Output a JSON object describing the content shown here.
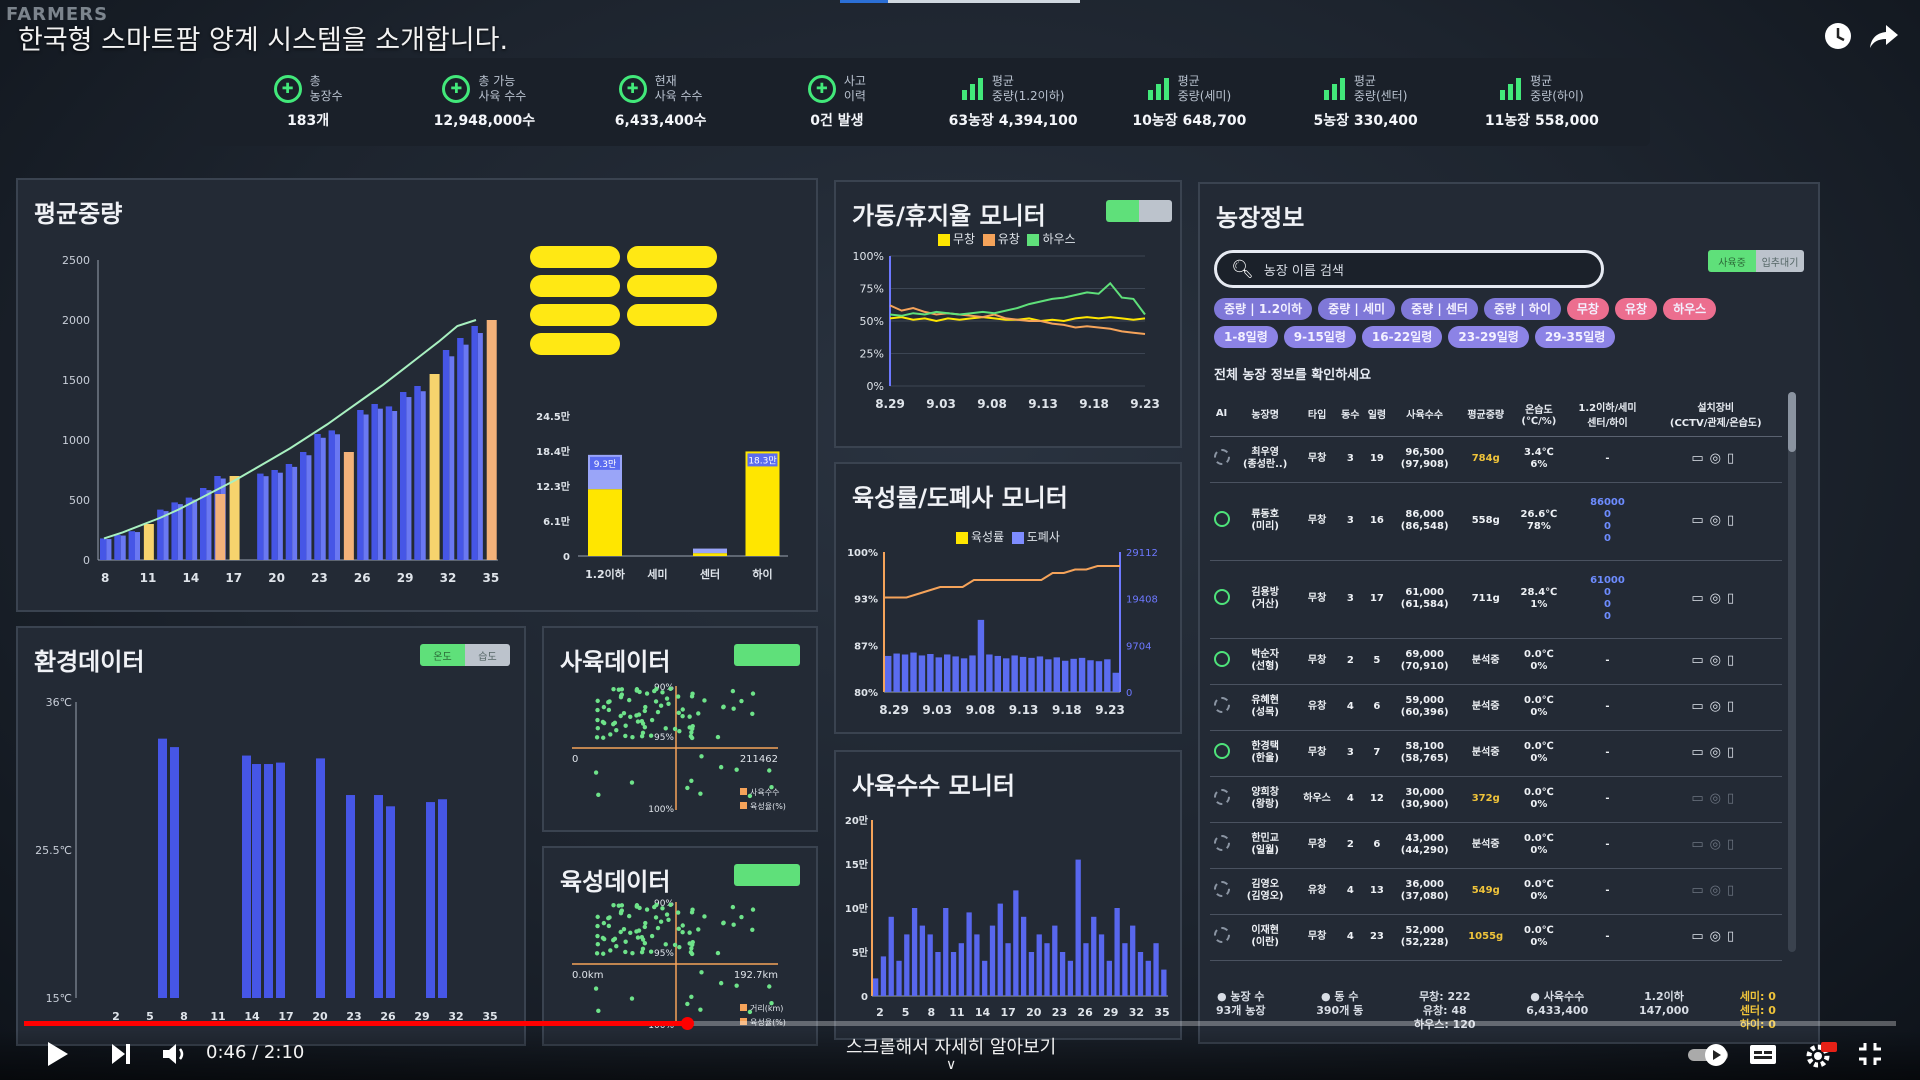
{
  "video": {
    "brand": "FARMERS",
    "title": "한국형 스마트팜 양계 시스템을 소개합니다.",
    "time": "0:46 / 2:10",
    "progress": 0.354,
    "scroll_hint": "스크롤해서 자세히 알아보기",
    "icons": [
      "clock-icon",
      "share-icon",
      "play-icon",
      "next-icon",
      "volume-icon",
      "autoplay-toggle",
      "captions-icon",
      "settings-icon",
      "fullscreen-exit-icon"
    ]
  },
  "stats": [
    {
      "label1": "총",
      "label2": "농장수",
      "value": "183개",
      "icon": "farm-icon"
    },
    {
      "label1": "총 가능",
      "label2": "사육 수수",
      "value": "12,948,000수",
      "icon": "capacity-icon"
    },
    {
      "label1": "현재",
      "label2": "사육 수수",
      "value": "6,433,400수",
      "icon": "current-icon"
    },
    {
      "label1": "사고",
      "label2": "이력",
      "value": "0건 발생",
      "icon": "accident-icon"
    },
    {
      "label1": "평균",
      "label2": "중량(1.2이하)",
      "value": "63농장 4,394,100",
      "icon": "bar-chart-icon"
    },
    {
      "label1": "평균",
      "label2": "중량(세미)",
      "value": "10농장 648,700",
      "icon": "bar-chart-icon"
    },
    {
      "label1": "평균",
      "label2": "중량(센터)",
      "value": "5농장 330,400",
      "icon": "bar-chart-icon"
    },
    {
      "label1": "평균",
      "label2": "중량(하이)",
      "value": "11농장 558,000",
      "icon": "bar-chart-icon"
    }
  ],
  "panels": {
    "avg_weight": {
      "title": "평균중량"
    },
    "operation": {
      "title": "가동/휴지율 모니터",
      "legend": [
        "무창",
        "유창",
        "하우스"
      ],
      "toggle": [
        "",
        ""
      ]
    },
    "growth": {
      "title": "육성률/도폐사 모니터",
      "legend": [
        "육성률",
        "도폐사"
      ]
    },
    "count": {
      "title": "사육수수 모니터"
    },
    "env": {
      "title": "환경데이터",
      "toggle": [
        "온도",
        "습도"
      ]
    },
    "breeding": {
      "title": "사육데이터",
      "legend": [
        "사육수수",
        "육성율(%)"
      ]
    },
    "raising": {
      "title": "육성데이터",
      "legend": [
        "거리(km)",
        "육성율(%)"
      ]
    },
    "farm": {
      "title": "농장정보",
      "search_placeholder": "농장 이름 검색",
      "toggle": [
        "사육중",
        "입추대기"
      ],
      "chips_row1": [
        "중량 | 1.2이하",
        "중량 | 세미",
        "중량 | 센터",
        "중량 | 하이",
        "무창",
        "유창",
        "하우스"
      ],
      "chips_row2": [
        "1-8일령",
        "9-15일령",
        "16-22일령",
        "23-29일령",
        "29-35일령"
      ],
      "subtitle": "전체 농장 정보를 확인하세요",
      "columns": [
        "AI",
        "농장명",
        "타입",
        "동수",
        "일령",
        "사육수수",
        "평균중량",
        "온습도 (℃/%)",
        "1.2이하/세미 센터/하이",
        "설치장비 (CCTV/관제/온습도)"
      ],
      "rows": [
        {
          "ai": false,
          "name": "최우영\n(종성란..)",
          "type": "무창",
          "dong": "3",
          "age": "19",
          "count": "96,500\n(97,908)",
          "weight": "784g",
          "weight_gold": true,
          "th": "3.4℃\n6%",
          "grade": "-"
        },
        {
          "ai": true,
          "name": "류동호\n(미리)",
          "type": "무창",
          "dong": "3",
          "age": "16",
          "count": "86,000\n(86,548)",
          "weight": "558g",
          "weight_gold": false,
          "th": "26.6℃\n78%",
          "grade": "86000\n0\n0\n0"
        },
        {
          "ai": true,
          "name": "김용방\n(거산)",
          "type": "무창",
          "dong": "3",
          "age": "17",
          "count": "61,000\n(61,584)",
          "weight": "711g",
          "weight_gold": false,
          "th": "28.4℃\n1%",
          "grade": "61000\n0\n0\n0"
        },
        {
          "ai": true,
          "name": "박순자\n(선형)",
          "type": "무창",
          "dong": "2",
          "age": "5",
          "count": "69,000\n(70,910)",
          "weight": "분석중",
          "weight_gold": false,
          "th": "0.0℃\n0%",
          "grade": "-"
        },
        {
          "ai": false,
          "name": "유혜현\n(성목)",
          "type": "유창",
          "dong": "4",
          "age": "6",
          "count": "59,000\n(60,396)",
          "weight": "분석중",
          "weight_gold": false,
          "th": "0.0℃\n0%",
          "grade": "-"
        },
        {
          "ai": true,
          "name": "한경택\n(한울)",
          "type": "무창",
          "dong": "3",
          "age": "7",
          "count": "58,100\n(58,765)",
          "weight": "분석중",
          "weight_gold": false,
          "th": "0.0℃\n0%",
          "grade": "-"
        },
        {
          "ai": false,
          "name": "양희창\n(왕랑)",
          "type": "하우스",
          "dong": "4",
          "age": "12",
          "count": "30,000\n(30,900)",
          "weight": "372g",
          "weight_gold": true,
          "th": "0.0℃\n0%",
          "grade": "-"
        },
        {
          "ai": false,
          "name": "한민교\n(일월)",
          "type": "무창",
          "dong": "2",
          "age": "6",
          "count": "43,000\n(44,290)",
          "weight": "분석중",
          "weight_gold": false,
          "th": "0.0℃\n0%",
          "grade": "-"
        },
        {
          "ai": false,
          "name": "김영오\n(김영오)",
          "type": "유창",
          "dong": "4",
          "age": "13",
          "count": "36,000\n(37,080)",
          "weight": "549g",
          "weight_gold": true,
          "th": "0.0℃\n0%",
          "grade": "-"
        },
        {
          "ai": false,
          "name": "이재현\n(이란)",
          "type": "무창",
          "dong": "4",
          "age": "23",
          "count": "52,000\n(52,228)",
          "weight": "1055g",
          "weight_gold": true,
          "th": "0.0℃\n0%",
          "grade": "-"
        }
      ],
      "footer": [
        {
          "label": "농장 수",
          "value": "93개 농장"
        },
        {
          "label": "동 수",
          "value": "390개 동"
        },
        {
          "label": "무창: 222",
          "value": "유창: 48\n하우스: 120"
        },
        {
          "label": "사육수수",
          "value": "6,433,400"
        },
        {
          "label": "1.2이하",
          "value": "147,000"
        },
        {
          "label": "세미: 0",
          "value": "센터: 0\n하이: 0"
        }
      ]
    }
  },
  "chart_data": [
    {
      "type": "bar",
      "title": "평균중량",
      "categories": [
        8,
        9,
        10,
        11,
        12,
        13,
        14,
        15,
        16,
        17,
        18,
        19,
        20,
        21,
        22,
        23,
        24,
        25,
        26,
        27,
        28,
        29,
        30,
        31,
        32,
        33,
        34,
        35
      ],
      "x_ticks": [
        8,
        11,
        14,
        17,
        20,
        23,
        26,
        29,
        32,
        35
      ],
      "values": [
        180,
        210,
        240,
        0,
        420,
        480,
        520,
        600,
        700,
        0,
        0,
        720,
        750,
        800,
        900,
        1050,
        1080,
        0,
        1250,
        1300,
        1280,
        1400,
        1450,
        0,
        1750,
        1850,
        1950,
        0
      ],
      "highlight": [
        3,
        8,
        9,
        17,
        23,
        27
      ],
      "highlight_values": [
        300,
        550,
        700,
        900,
        1550,
        2000
      ],
      "line": [
        180,
        230,
        290,
        350,
        420,
        500,
        580,
        660,
        750,
        840,
        930,
        1030,
        1130,
        1240,
        1350,
        1460,
        1580,
        1700,
        1820,
        1950,
        2000
      ],
      "ylim": [
        0,
        2500
      ],
      "y_ticks": [
        0,
        500,
        1000,
        1500,
        2000,
        2500
      ]
    },
    {
      "type": "bar",
      "categories": [
        "1.2이하",
        "세미",
        "센터",
        "하이"
      ],
      "series": [
        {
          "values": [
            11.7,
            0,
            0.5,
            18.3
          ],
          "color": "#ffe600"
        },
        {
          "values": [
            6.0,
            0,
            0.8,
            0
          ],
          "color": "#9aa5f8"
        }
      ],
      "data_labels": [
        "9.3만",
        "",
        "",
        "18.3만"
      ],
      "y_ticks": [
        "0",
        "6.1만",
        "12.3만",
        "18.4만",
        "24.5만"
      ],
      "ylim": [
        0,
        24.5
      ]
    },
    {
      "type": "line",
      "title": "가동/휴지율 모니터",
      "x_ticks": [
        "8.29",
        "9.03",
        "9.08",
        "9.13",
        "9.18",
        "9.23"
      ],
      "y_ticks": [
        "0%",
        "25%",
        "50%",
        "75%",
        "100%"
      ],
      "series": [
        {
          "name": "무창",
          "values": [
            52,
            53,
            51,
            52,
            50,
            52,
            51,
            52,
            53,
            52,
            51,
            51,
            52,
            50,
            51,
            50,
            52,
            53,
            52,
            53,
            52,
            51,
            52
          ],
          "color": "#ffe600"
        },
        {
          "name": "유창",
          "values": [
            62,
            58,
            60,
            57,
            55,
            56,
            55,
            54,
            53,
            55,
            52,
            51,
            50,
            50,
            48,
            47,
            45,
            46,
            45,
            44,
            42,
            41,
            40
          ],
          "color": "#f5a35a"
        },
        {
          "name": "하우스",
          "values": [
            55,
            54,
            56,
            55,
            57,
            56,
            55,
            56,
            57,
            56,
            58,
            60,
            63,
            65,
            67,
            68,
            70,
            72,
            71,
            79,
            68,
            67,
            55
          ],
          "color": "#5fe07a"
        }
      ]
    },
    {
      "type": "bar",
      "title": "육성률/도폐사 모니터",
      "x_ticks": [
        "8.29",
        "9.03",
        "9.08",
        "9.13",
        "9.18",
        "9.23"
      ],
      "y_ticks_left": [
        "80%",
        "87%",
        "93%",
        "100%"
      ],
      "y_ticks_right": [
        "0",
        "9704",
        "19408",
        "29112"
      ],
      "series": [
        {
          "name": "육성률",
          "values": [
            93.5,
            93.5,
            93.5,
            94,
            94.5,
            95,
            95,
            95,
            96,
            96,
            96,
            96,
            96,
            96,
            96,
            97,
            97,
            97.5,
            97.5,
            98,
            98,
            98
          ],
          "color": "#f5a35a"
        },
        {
          "name": "도폐사",
          "values": [
            7500,
            8000,
            7800,
            8200,
            7600,
            7900,
            7200,
            7800,
            7400,
            7000,
            7600,
            15000,
            7800,
            7500,
            7000,
            7600,
            7300,
            7100,
            7400,
            6800,
            7200,
            6500,
            6900,
            7100,
            6600,
            6400,
            6800,
            4000
          ],
          "color": "#5b6cf0"
        }
      ]
    },
    {
      "type": "bar",
      "title": "사육수수 모니터",
      "x_ticks": [
        2,
        5,
        8,
        11,
        14,
        17,
        20,
        23,
        26,
        29,
        32,
        35
      ],
      "y_ticks": [
        "0",
        "5만",
        "10만",
        "15만",
        "20만"
      ],
      "values": [
        2,
        4.5,
        9,
        4,
        7,
        10,
        8,
        7,
        5,
        10,
        5,
        6,
        9.5,
        7,
        4,
        8,
        10.5,
        6,
        12,
        9,
        5,
        7,
        6,
        8,
        5,
        4,
        15.5,
        6,
        9,
        7,
        4,
        10,
        6,
        8,
        5,
        4,
        6,
        3
      ],
      "ylim": [
        0,
        20
      ]
    },
    {
      "type": "bar",
      "title": "환경데이터",
      "x_ticks": [
        2,
        5,
        8,
        11,
        14,
        17,
        20,
        23,
        26,
        29,
        32,
        35
      ],
      "y_ticks": [
        "15℃",
        "25.5℃",
        "36℃"
      ],
      "values": [
        33.4,
        32.8,
        0,
        32.2,
        31.6,
        31.6,
        31.7,
        32.0,
        29.4,
        29.4,
        28.6,
        28.9,
        29.1
      ],
      "ylim": [
        15,
        36
      ]
    },
    {
      "type": "scatter",
      "title": "사육데이터",
      "x_ticks": [
        "0",
        "211462"
      ],
      "y_ticks": [
        "90%",
        "95%",
        "100%"
      ],
      "series": [
        {
          "name": "사육수수"
        },
        {
          "name": "육성율(%)"
        }
      ]
    },
    {
      "type": "scatter",
      "title": "육성데이터",
      "x_ticks": [
        "0.0km",
        "192.7km"
      ],
      "y_ticks": [
        "90%",
        "95%",
        "100%"
      ],
      "series": [
        {
          "name": "거리(km)"
        },
        {
          "name": "육성율(%)"
        }
      ]
    }
  ]
}
